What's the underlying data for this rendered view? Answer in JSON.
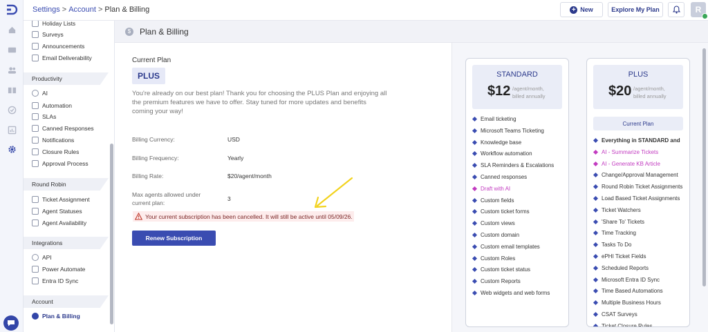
{
  "header": {
    "breadcrumb": [
      "Settings",
      "Account",
      "Plan & Billing"
    ],
    "breadcrumb_sep": ">",
    "new_label": "New",
    "explore_label": "Explore My Plan",
    "avatar_initial": "R"
  },
  "sidebar": {
    "top_items": [
      "Holiday Lists",
      "Surveys",
      "Announcements",
      "Email Deliverability"
    ],
    "sections": [
      {
        "title": "Productivity",
        "items": [
          "AI",
          "Automation",
          "SLAs",
          "Canned Responses",
          "Notifications",
          "Closure Rules",
          "Approval Process"
        ]
      },
      {
        "title": "Round Robin",
        "items": [
          "Ticket Assignment",
          "Agent Statuses",
          "Agent Availability"
        ]
      },
      {
        "title": "Integrations",
        "items": [
          "API",
          "Power Automate",
          "Entra ID Sync"
        ]
      },
      {
        "title": "Account",
        "items": [
          "Plan & Billing"
        ]
      }
    ]
  },
  "page": {
    "title": "Plan & Billing",
    "current_plan_label": "Current Plan",
    "current_plan": "PLUS",
    "description": "You're already on our best plan! Thank you for choosing the PLUS Plan and enjoying all the premium features we have to offer. Stay tuned for more updates and benefits coming your way!",
    "billing": [
      {
        "label": "Billing Currency:",
        "value": "USD"
      },
      {
        "label": "Billing Frequency:",
        "value": "Yearly"
      },
      {
        "label": "Billing Rate:",
        "value": "$20/agent/month"
      },
      {
        "label": "Max agents allowed under current plan:",
        "value": "3"
      }
    ],
    "warning": "Your current subscription has been cancelled. It will still be active until 05/09/26.",
    "renew_label": "Renew Subscription"
  },
  "plans": [
    {
      "name": "STANDARD",
      "price": "$12",
      "per_line1": "/agent/month,",
      "per_line2": "billed annually",
      "features": [
        {
          "text": "Email ticketing"
        },
        {
          "text": "Microsoft Teams Ticketing"
        },
        {
          "text": "Knowledge base"
        },
        {
          "text": "Workflow automation"
        },
        {
          "text": "SLA Reminders & Escalations"
        },
        {
          "text": "Canned responses"
        },
        {
          "text": "Draft with AI",
          "highlight": true
        },
        {
          "text": "Custom fields"
        },
        {
          "text": "Custom ticket forms"
        },
        {
          "text": "Custom views"
        },
        {
          "text": "Custom domain"
        },
        {
          "text": "Custom email templates"
        },
        {
          "text": "Custom Roles"
        },
        {
          "text": "Custom ticket status"
        },
        {
          "text": "Custom Reports"
        },
        {
          "text": "Web widgets and web forms"
        }
      ]
    },
    {
      "name": "PLUS",
      "price": "$20",
      "per_line1": "/agent/month,",
      "per_line2": "billed annually",
      "current_label": "Current Plan",
      "features": [
        {
          "text": "Everything in STANDARD and",
          "bold": true
        },
        {
          "text": "AI - Summarize Tickets",
          "highlight": true
        },
        {
          "text": "AI - Generate KB Article",
          "highlight": true
        },
        {
          "text": "Change/Approval Management"
        },
        {
          "text": "Round Robin Ticket Assignments"
        },
        {
          "text": "Load Based Ticket Assignments"
        },
        {
          "text": "Ticket Watchers"
        },
        {
          "text": "'Share To' Tickets"
        },
        {
          "text": "Time Tracking"
        },
        {
          "text": "Tasks To Do"
        },
        {
          "text": "ePHI Ticket Fields"
        },
        {
          "text": "Scheduled Reports"
        },
        {
          "text": "Microsoft Entra ID Sync"
        },
        {
          "text": "Time Based Automations"
        },
        {
          "text": "Multiple Business Hours"
        },
        {
          "text": "CSAT Surveys"
        },
        {
          "text": "Ticket Closure Rules"
        }
      ]
    }
  ],
  "colors": {
    "accent": "#3a4cb1",
    "highlight": "#c23bc0",
    "warning_bg": "#fdecec",
    "arrow": "#f2d21c"
  }
}
